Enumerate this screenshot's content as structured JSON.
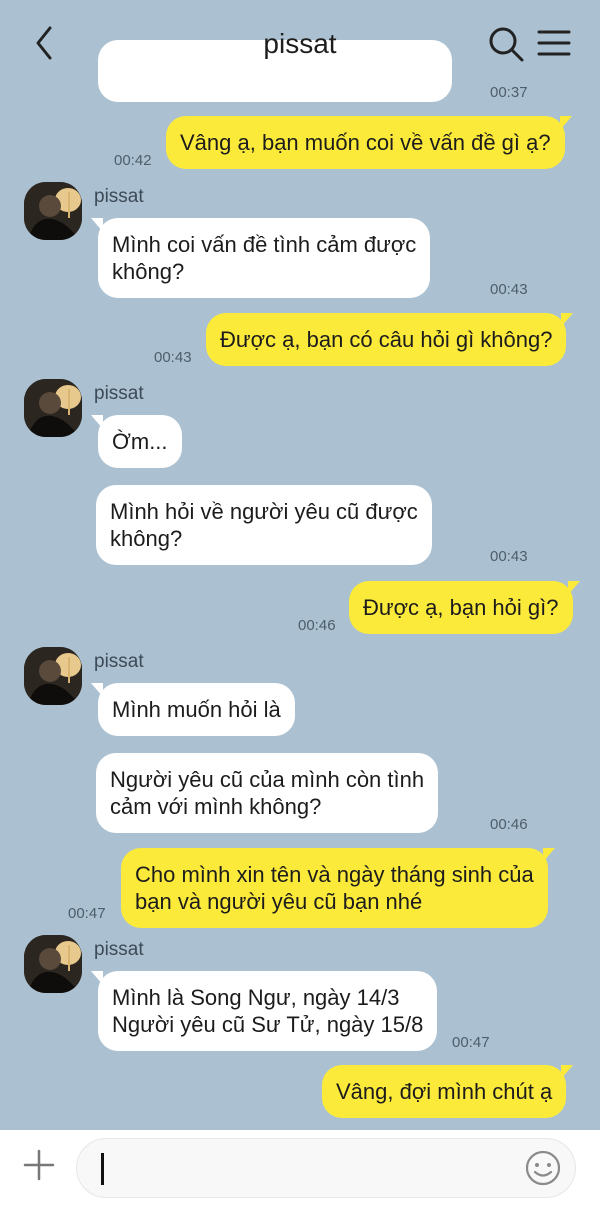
{
  "header": {
    "title": "pissat"
  },
  "messages": [
    {
      "time": "00:37"
    },
    {
      "text": "Vâng ạ, bạn muốn coi về vấn đề gì ạ?",
      "time": "00:42"
    },
    {
      "sender": "pissat",
      "lines": [
        "Mình coi vấn đề tình cảm được",
        "không?"
      ],
      "time": "00:43"
    },
    {
      "text": "Được ạ, bạn có câu hỏi gì không?",
      "time": "00:43"
    },
    {
      "sender": "pissat",
      "text": "Ờm..."
    },
    {
      "lines": [
        "Mình hỏi về người yêu cũ được",
        "không?"
      ],
      "time": "00:43"
    },
    {
      "text": "Được ạ, bạn hỏi gì?",
      "time": "00:46"
    },
    {
      "sender": "pissat",
      "text": "Mình muốn hỏi là"
    },
    {
      "lines": [
        "Người yêu cũ của mình còn tình",
        "cảm với mình không?"
      ],
      "time": "00:46"
    },
    {
      "lines": [
        "Cho mình xin tên và ngày tháng sinh của",
        "bạn và người yêu cũ bạn nhé"
      ],
      "time": "00:47"
    },
    {
      "sender": "pissat",
      "lines": [
        "Mình là Song Ngư, ngày 14/3",
        "Người yêu cũ Sư Tử, ngày 15/8"
      ],
      "time": "00:47"
    },
    {
      "text": "Vâng, đợi mình chút ạ"
    }
  ],
  "colors": {
    "background": "#abc1d1",
    "incoming_bubble": "#ffffff",
    "outgoing_bubble": "#fcea3a"
  },
  "icons": {
    "back": "chevron-left-icon",
    "search": "search-icon",
    "menu": "hamburger-menu-icon",
    "attach": "plus-icon",
    "emoji": "emoji-icon"
  }
}
